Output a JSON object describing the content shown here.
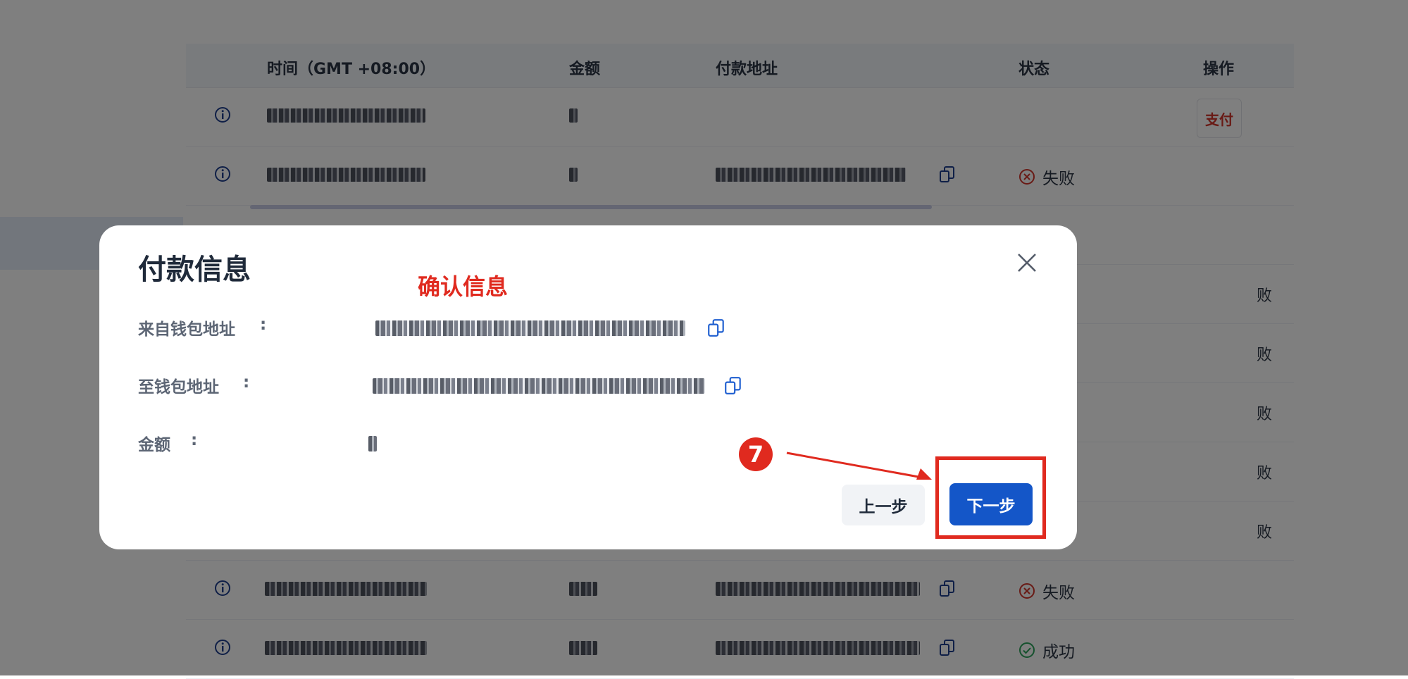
{
  "table": {
    "headers": {
      "time": "时间（GMT +08:00）",
      "amount": "金额",
      "address": "付款地址",
      "status": "状态",
      "action": "操作"
    },
    "rows": [
      {
        "status": "",
        "action": "支付"
      },
      {
        "status": "失败"
      },
      {
        "status": "失败"
      },
      {
        "status": "成功"
      }
    ],
    "partial_status_chars": [
      "败",
      "败",
      "败",
      "败",
      "败"
    ]
  },
  "modal": {
    "title": "付款信息",
    "annotation": "确认信息",
    "fields": {
      "from_label": "来自钱包地址",
      "to_label": "至钱包地址",
      "amount_label": "金额",
      "colon": ":"
    },
    "prev_label": "上一步",
    "next_label": "下一步"
  },
  "tutorial": {
    "step_number": "7"
  },
  "colors": {
    "primary": "#1456c8",
    "annotation_red": "#e02a1f",
    "fail_red": "#d3342a",
    "success_green": "#2aa35a"
  }
}
